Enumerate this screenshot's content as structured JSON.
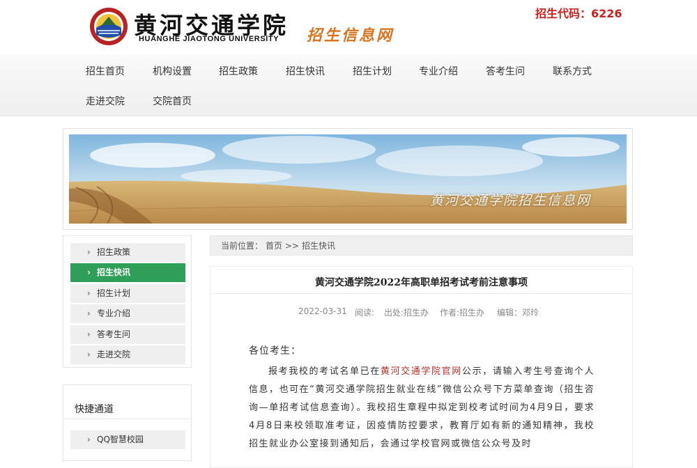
{
  "header": {
    "school_name_cn": "黄河交通学院",
    "school_name_en": "HUANGHE JIAOTONG UNIVERSITY",
    "site_name": "招生信息网",
    "enroll_code": "招生代码：6226"
  },
  "nav": {
    "items": [
      "招生首页",
      "机构设置",
      "招生政策",
      "招生快讯",
      "招生计划",
      "专业介绍",
      "答考生问",
      "联系方式",
      "走进交院",
      "交院首页"
    ]
  },
  "banner": {
    "watermark": "黄河交通学院招生信息网"
  },
  "sidebar": {
    "items": [
      "招生政策",
      "招生快讯",
      "招生计划",
      "专业介绍",
      "答考生问",
      "走进交院"
    ],
    "active": "招生快讯",
    "active_color": "#2e9e58"
  },
  "quick": {
    "title": "快捷通道",
    "items": [
      "QQ智慧校园"
    ]
  },
  "breadcrumb": {
    "label": "当前位置：",
    "home": "首页",
    "sep": ">>",
    "current": "招生快讯"
  },
  "article": {
    "title": "黄河交通学院2022年高职单招考试考前注意事项",
    "date": "2022-03-31",
    "views": "阅读:",
    "source": "出处:招生办",
    "author": "作者:招生办",
    "editor": "编辑：邓玲",
    "greeting": "各位考生：",
    "para_before": "报考我校的考试名单已在",
    "para_highlight": "黄河交通学院官网",
    "para_after": "公示，请输入考生号查询个人信息，也可在“黄河交通学院招生就业在线”微信公众号下方菜单查询（招生咨询—单招考试信息查询）。我校招生章程中拟定到校考试时间为4月9日，要求4月8日来校领取准考证，因疫情防控要求，教育厅如有新的通知精神，我校招生就业办公室接到通知后，会通过学校官网或微信公众号及时"
  },
  "colors": {
    "accent_green": "#2e9e58",
    "code_red": "#cc1f1f",
    "site_orange": "#d9731f",
    "link_red": "#b8302a"
  }
}
